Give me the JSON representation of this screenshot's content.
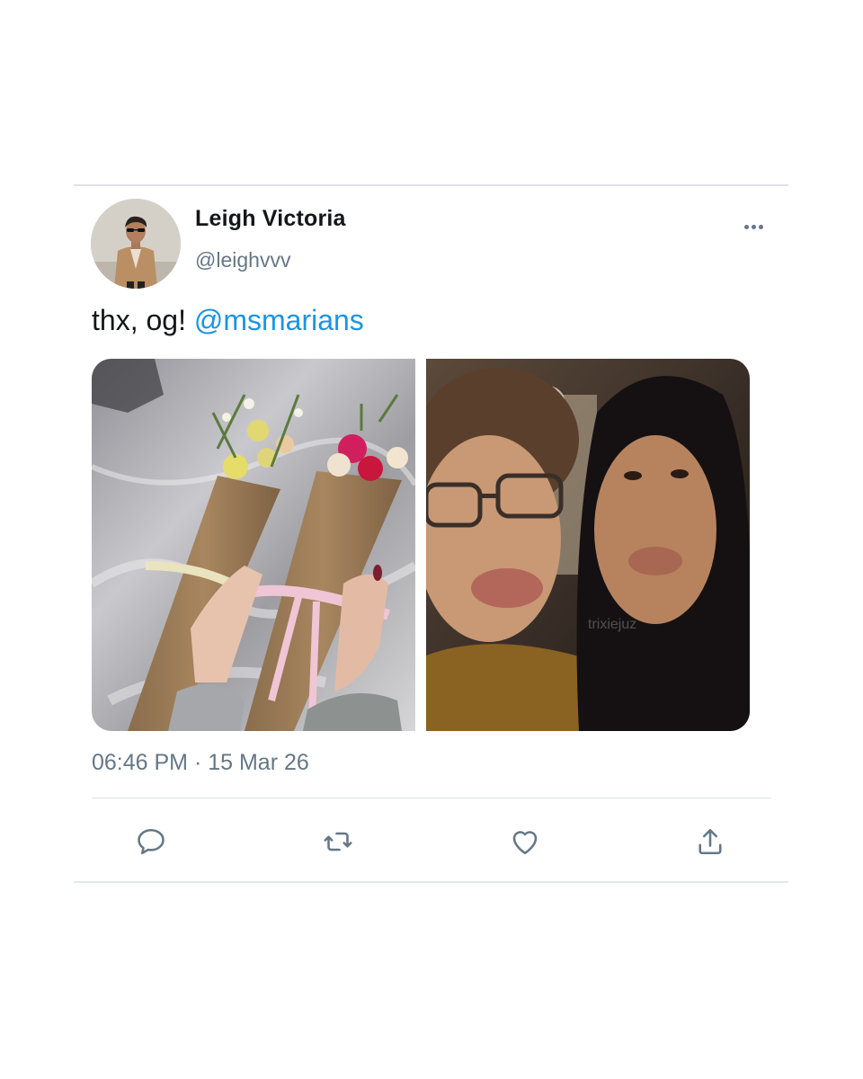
{
  "tweet": {
    "author": {
      "display_name": "Leigh Victoria",
      "handle": "@leighvvv"
    },
    "text_prefix": "thx, og! ",
    "mention": "@msmarians",
    "timestamp": "06:46 PM · 15 Mar 26",
    "media": [
      {
        "description": "two kraft-paper flower bouquets tied with ribbons"
      },
      {
        "description": "selfie of two people making kissy faces"
      }
    ]
  },
  "icons": {
    "more": "more-horizontal-icon",
    "reply": "reply-bubble-icon",
    "retweet": "retweet-arrows-icon",
    "like": "heart-icon",
    "share": "share-upload-icon"
  },
  "colors": {
    "mention": "#1b95e0",
    "secondary_text": "#657786",
    "primary_text": "#14171a"
  }
}
